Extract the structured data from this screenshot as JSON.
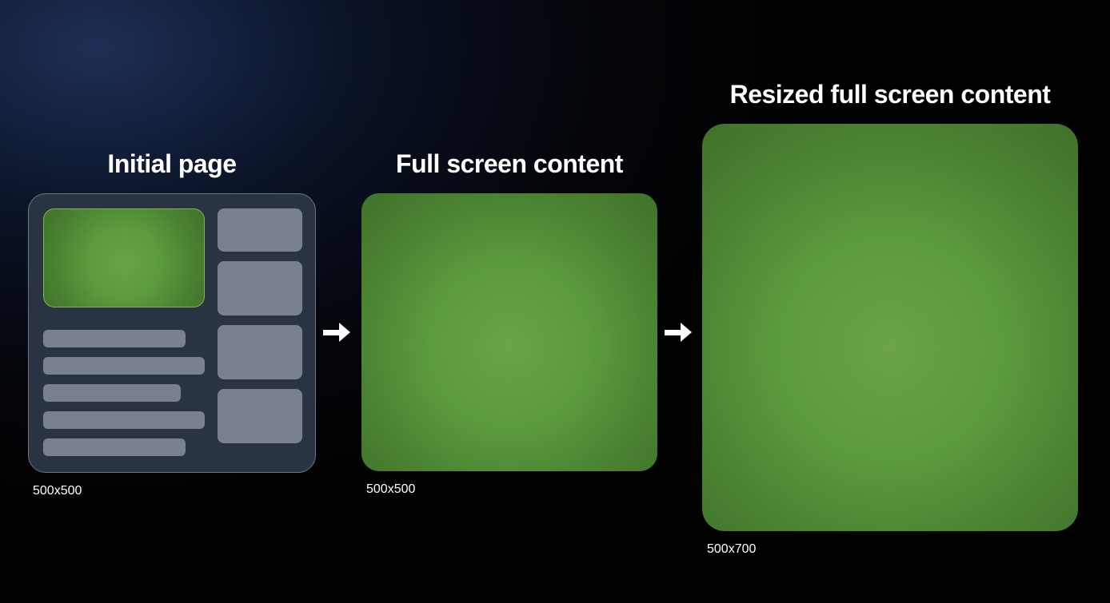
{
  "panels": {
    "initial": {
      "title": "Initial page",
      "caption": "500x500"
    },
    "full": {
      "title": "Full screen content",
      "caption": "500x500"
    },
    "resized": {
      "title": "Resized full screen content",
      "caption": "500x700"
    }
  }
}
